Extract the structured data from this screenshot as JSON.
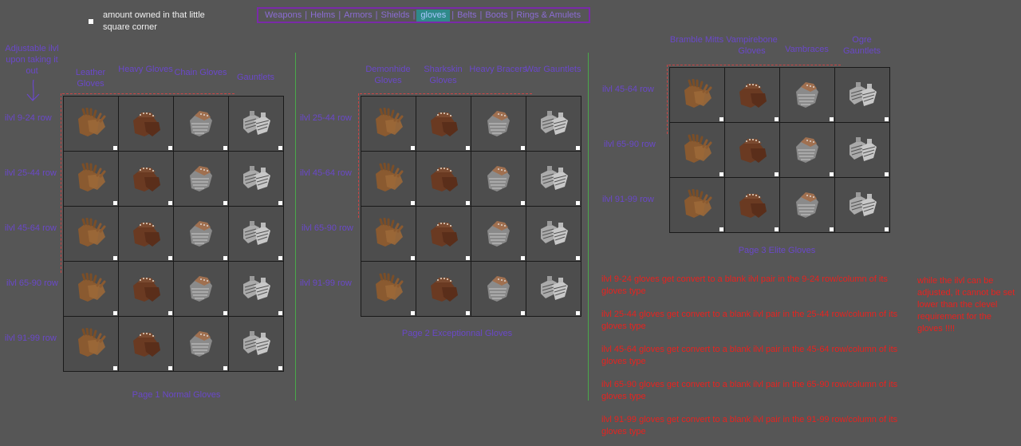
{
  "legend": {
    "text": "amount owned in that little square corner"
  },
  "tabs": [
    {
      "label": "Weapons"
    },
    {
      "label": "Helms"
    },
    {
      "label": "Armors"
    },
    {
      "label": "Shields"
    },
    {
      "label": "gloves",
      "active": true
    },
    {
      "label": "Belts"
    },
    {
      "label": "Boots"
    },
    {
      "label": "Rings & Amulets"
    }
  ],
  "adjustable_note": "Adjustable ilvl upon taking it out",
  "icons": [
    "leather-gloves-icon",
    "heavy-gloves-icon",
    "chain-gloves-icon",
    "gauntlets-icon"
  ],
  "colors": {
    "tab_border": "#7a2aa8",
    "active_tab": "#2f8a8a",
    "label": "#6a48c9",
    "note": "#e8221f",
    "divider": "#4aa84a"
  },
  "page1": {
    "caption": "Page 1 Normal Gloves",
    "columns": [
      "Leather Gloves",
      "Heavy Gloves",
      "Chain Gloves",
      "Gauntlets"
    ],
    "rows": [
      "ilvl 9-24 row",
      "ilvl 25-44 row",
      "ilvl 45-64 row",
      "ilvl 65-90 row",
      "ilvl 91-99 row"
    ]
  },
  "page2": {
    "caption": "Page 2 Exceptionnal Gloves",
    "columns": [
      "Demonhide Gloves",
      "Sharkskin Gloves",
      "Heavy Bracers",
      "War Gauntlets"
    ],
    "rows": [
      "ilvl 25-44 row",
      "ilvl 45-64 row",
      "ilvl 65-90 row",
      "ilvl 91-99 row"
    ]
  },
  "page3": {
    "caption": "Page 3 Elite Gloves",
    "columns": [
      "Bramble Mitts",
      "Vampirebone Gloves",
      "Vambraces",
      "Ogre Gauntlets"
    ],
    "rows": [
      "ilvl 45-64 row",
      "ilvl 65-90 row",
      "ilvl 91-99 row"
    ]
  },
  "notes": [
    "ilvl 9-24 gloves get convert to a blank ilvl pair in the 9-24 row/column of its gloves type",
    "ilvl 25-44 gloves get convert to a blank ilvl pair in the 25-44 row/column of its gloves type",
    "ilvl 45-64 gloves get convert to a blank ilvl pair in the 45-64 row/column of its gloves type",
    "ilvl 65-90 gloves get convert to a blank ilvl pair in the 65-90 row/column of its gloves type",
    "ilvl 91-99 gloves get convert to a blank ilvl pair in the 91-99 row/column of its gloves type"
  ],
  "side_note": "while the ilvl can be adjusted, it cannot be set lower than the clevel requirement for the gloves !!!!"
}
